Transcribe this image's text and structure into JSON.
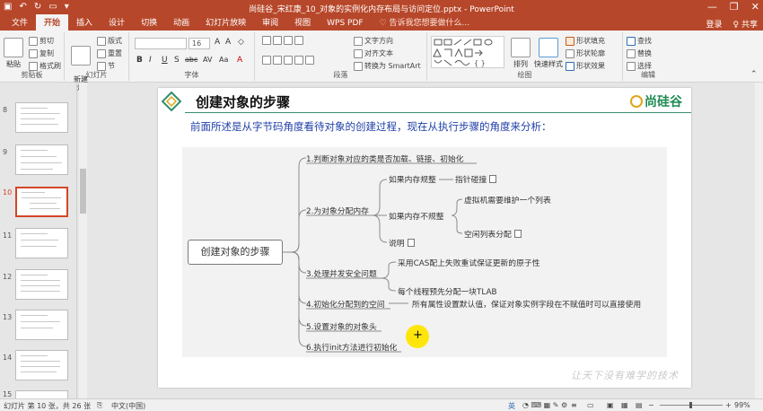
{
  "app": {
    "window_title": "尚硅谷_宋红康_10_对象的实例化内存布局与访问定位.pptx - PowerPoint",
    "title_controls": [
      "—",
      "❐",
      "✕"
    ]
  },
  "tabs": {
    "items": [
      "文件",
      "开始",
      "插入",
      "设计",
      "切换",
      "动画",
      "幻灯片放映",
      "审阅",
      "视图",
      "WPS PDF"
    ],
    "active": "开始",
    "tell_me": "♡ 告诉我您想要做什么...",
    "login": "登录",
    "share": "♀ 共享"
  },
  "ribbon": {
    "clipboard": {
      "label": "剪贴板",
      "paste": "粘贴",
      "cut": "剪切",
      "copy": "复制",
      "format_painter": "格式刷"
    },
    "slides": {
      "label": "幻灯片",
      "new_slide": "新建\n幻灯片",
      "layout": "版式",
      "reset": "重置",
      "section": "节"
    },
    "font": {
      "label": "字体",
      "font_size": "16",
      "buttons": [
        "B",
        "I",
        "U",
        "S",
        "abc",
        "AV",
        "Aa",
        "A"
      ]
    },
    "paragraph": {
      "label": "段落",
      "text_direction": "文字方向",
      "align_text": "对齐文本",
      "smartart": "转换为 SmartArt"
    },
    "drawing": {
      "label": "绘图",
      "arrange": "排列",
      "quick_styles": "快速样式",
      "shape_fill": "形状填充",
      "shape_outline": "形状轮廓",
      "shape_effects": "形状效果"
    },
    "editing": {
      "label": "编辑",
      "find": "查找",
      "replace": "替换",
      "select": "选择"
    }
  },
  "thumbnails": [
    {
      "num": "8"
    },
    {
      "num": "9"
    },
    {
      "num": "10",
      "active": true
    },
    {
      "num": "11"
    },
    {
      "num": "12"
    },
    {
      "num": "13"
    },
    {
      "num": "14"
    },
    {
      "num": "15"
    }
  ],
  "slide": {
    "title": "创建对象的步骤",
    "brand": "尚硅谷",
    "subtitle": "前面所述是从字节码角度看待对象的创建过程，现在从执行步骤的角度来分析：",
    "root": "创建对象的步骤",
    "steps": {
      "s1": "1.判断对象对应的类是否加载、链接、初始化",
      "s2": "2.为对象分配内存",
      "s2a": "如果内存规整",
      "s2a1": "指针碰撞",
      "s2b": "如果内存不规整",
      "s2b1": "虚拟机需要维护一个列表",
      "s2b2": "空闲列表分配",
      "s2c": "说明",
      "s3": "3.处理并发安全问题",
      "s3a": "采用CAS配上失败重试保证更新的原子性",
      "s3b": "每个线程预先分配一块TLAB",
      "s4": "4.初始化分配到的空间",
      "s4a": "所有属性设置默认值，保证对象实例字段在不赋值时可以直接使用",
      "s5": "5.设置对象的对象头",
      "s6": "6.执行init方法进行初始化"
    },
    "cursor": "+",
    "watermark": "让天下没有难学的技术"
  },
  "status": {
    "slide_info": "幻灯片 第 10 张，共 26 张",
    "lang": "中文(中国)",
    "ime": "英",
    "zoom": "99%"
  },
  "colors": {
    "accent": "#b7472a",
    "subtitle": "#1f3fa8",
    "brand": "#1e8a52"
  }
}
